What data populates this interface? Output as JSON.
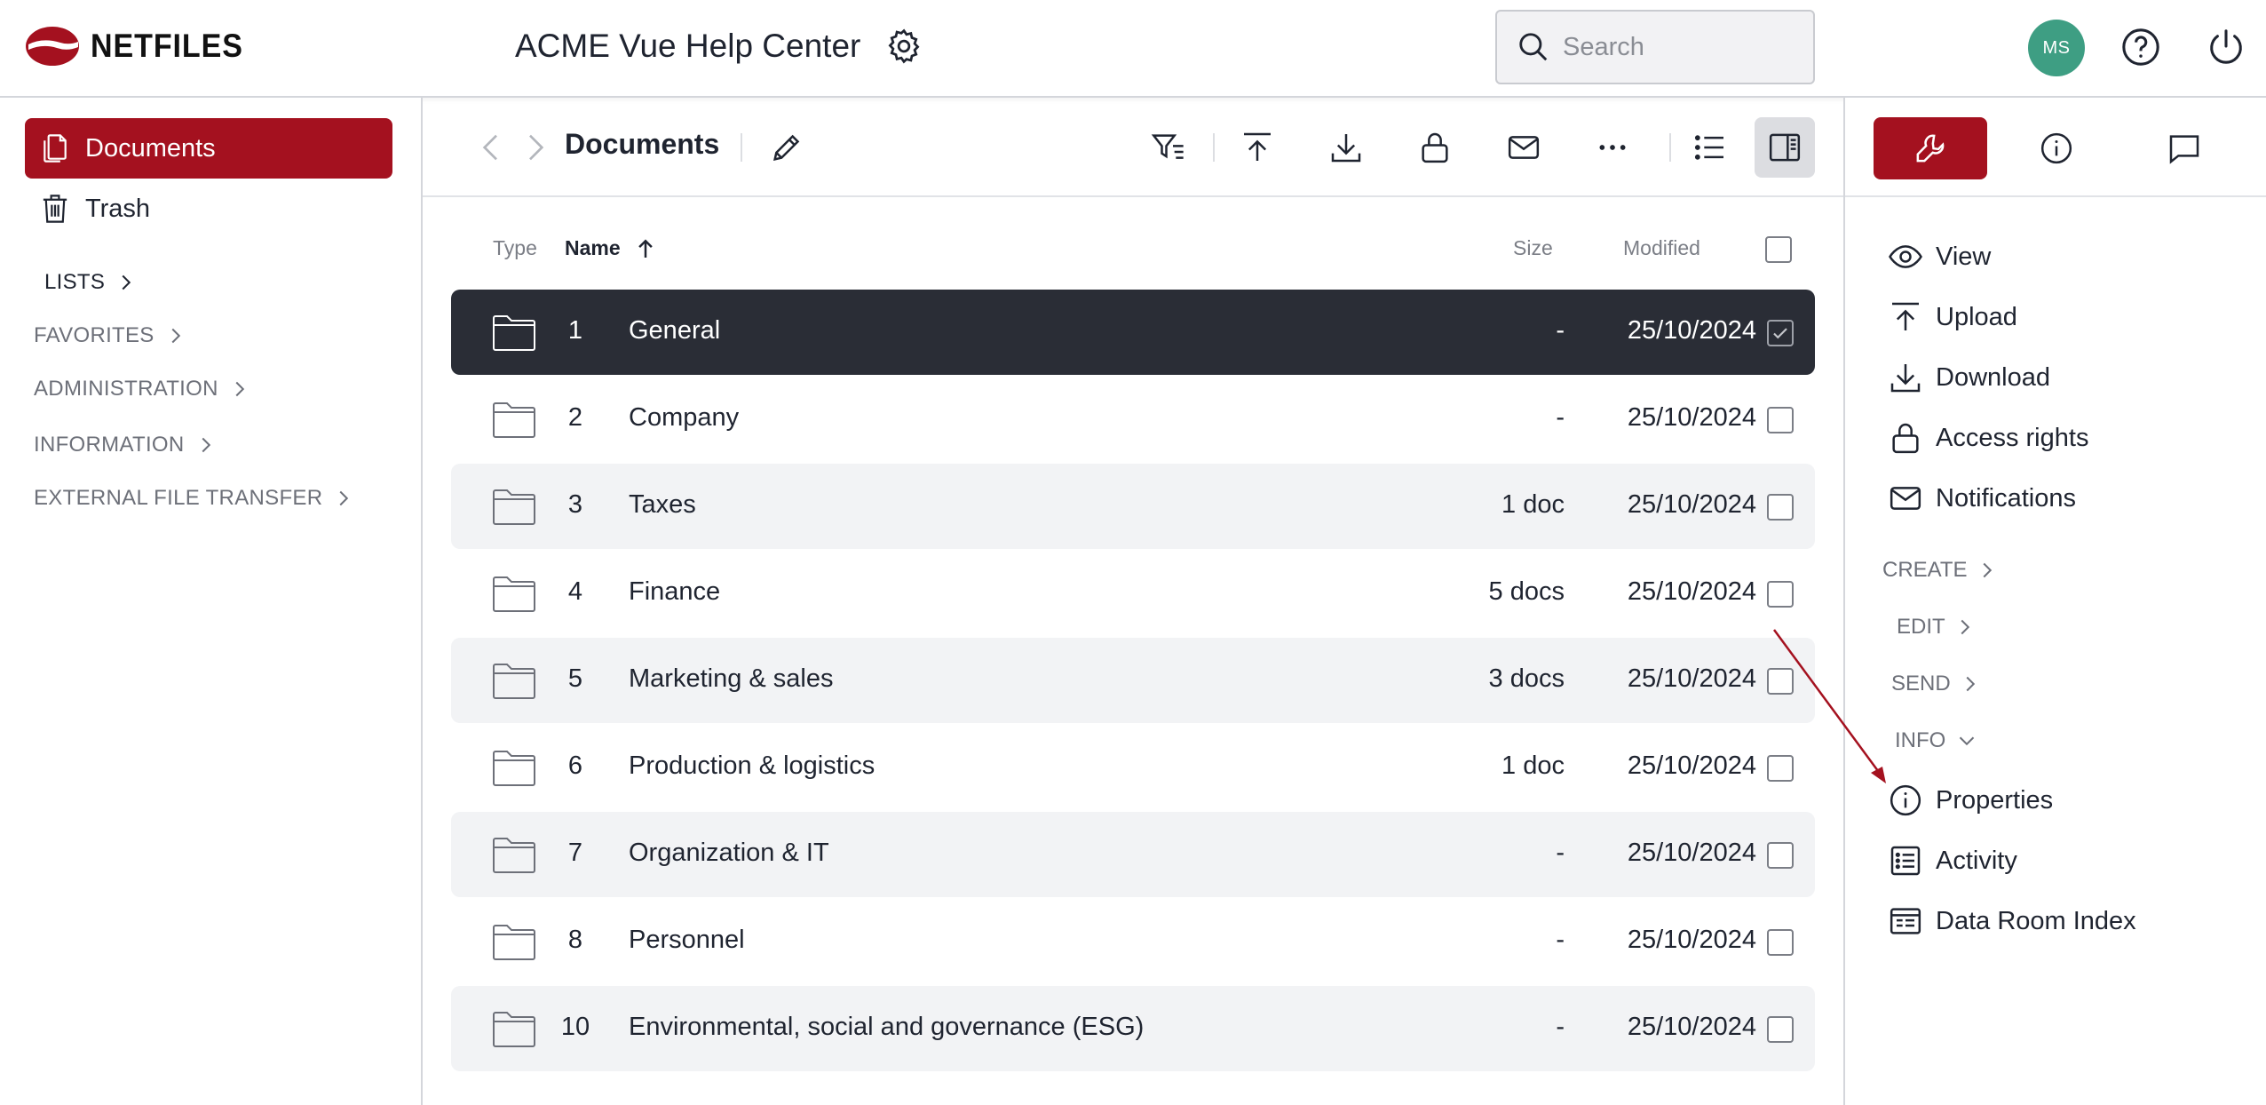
{
  "header": {
    "logo_text": "NETFILES",
    "app_title": "ACME Vue Help Center",
    "search_placeholder": "Search",
    "avatar_initials": "MS"
  },
  "sidebar": {
    "items": [
      {
        "label": "Documents",
        "icon": "documents-icon",
        "active": true
      },
      {
        "label": "Trash",
        "icon": "trash-icon",
        "active": false
      }
    ],
    "sections": [
      {
        "label": "LISTS"
      },
      {
        "label": "FAVORITES"
      },
      {
        "label": "ADMINISTRATION"
      },
      {
        "label": "INFORMATION"
      },
      {
        "label": "EXTERNAL FILE TRANSFER"
      }
    ]
  },
  "toolbar": {
    "title": "Documents",
    "icons": [
      "back-icon",
      "forward-icon",
      "rename-pencil-icon",
      "filter-icon",
      "upload-icon",
      "download-icon",
      "lock-icon",
      "mail-icon",
      "more-icon",
      "list-view-icon",
      "panel-toggle-icon"
    ]
  },
  "table": {
    "columns": {
      "type": "Type",
      "name": "Name",
      "size": "Size",
      "modified": "Modified"
    },
    "sort": {
      "column": "Name",
      "direction": "ascending"
    },
    "rows": [
      {
        "num": "1",
        "name": "General",
        "size": "-",
        "modified": "25/10/2024",
        "selected": true
      },
      {
        "num": "2",
        "name": "Company",
        "size": "-",
        "modified": "25/10/2024",
        "selected": false
      },
      {
        "num": "3",
        "name": "Taxes",
        "size": "1 doc",
        "modified": "25/10/2024",
        "selected": false
      },
      {
        "num": "4",
        "name": "Finance",
        "size": "5 docs",
        "modified": "25/10/2024",
        "selected": false
      },
      {
        "num": "5",
        "name": "Marketing & sales",
        "size": "3 docs",
        "modified": "25/10/2024",
        "selected": false
      },
      {
        "num": "6",
        "name": "Production & logistics",
        "size": "1 doc",
        "modified": "25/10/2024",
        "selected": false
      },
      {
        "num": "7",
        "name": "Organization & IT",
        "size": "-",
        "modified": "25/10/2024",
        "selected": false
      },
      {
        "num": "8",
        "name": "Personnel",
        "size": "-",
        "modified": "25/10/2024",
        "selected": false
      },
      {
        "num": "10",
        "name": "Environmental, social and governance (ESG)",
        "size": "-",
        "modified": "25/10/2024",
        "selected": false
      }
    ]
  },
  "right_panel": {
    "tabs": [
      "tools-wrench-icon",
      "info-icon",
      "comment-icon"
    ],
    "actions": [
      {
        "label": "View",
        "icon": "eye-icon"
      },
      {
        "label": "Upload",
        "icon": "upload-icon"
      },
      {
        "label": "Download",
        "icon": "download-icon"
      },
      {
        "label": "Access rights",
        "icon": "lock-icon"
      },
      {
        "label": "Notifications",
        "icon": "mail-icon"
      }
    ],
    "sections": [
      {
        "label": "CREATE",
        "expanded": false
      },
      {
        "label": "EDIT",
        "expanded": false
      },
      {
        "label": "SEND",
        "expanded": false
      },
      {
        "label": "INFO",
        "expanded": true
      }
    ],
    "info_items": [
      {
        "label": "Properties",
        "icon": "info-icon"
      },
      {
        "label": "Activity",
        "icon": "activity-list-icon"
      },
      {
        "label": "Data Room Index",
        "icon": "data-room-index-icon"
      }
    ]
  },
  "colors": {
    "brand": "#a4111f",
    "selected_row": "#2a2d36",
    "avatar": "#3e9e83",
    "annotation_arrow": "#a4111f"
  }
}
